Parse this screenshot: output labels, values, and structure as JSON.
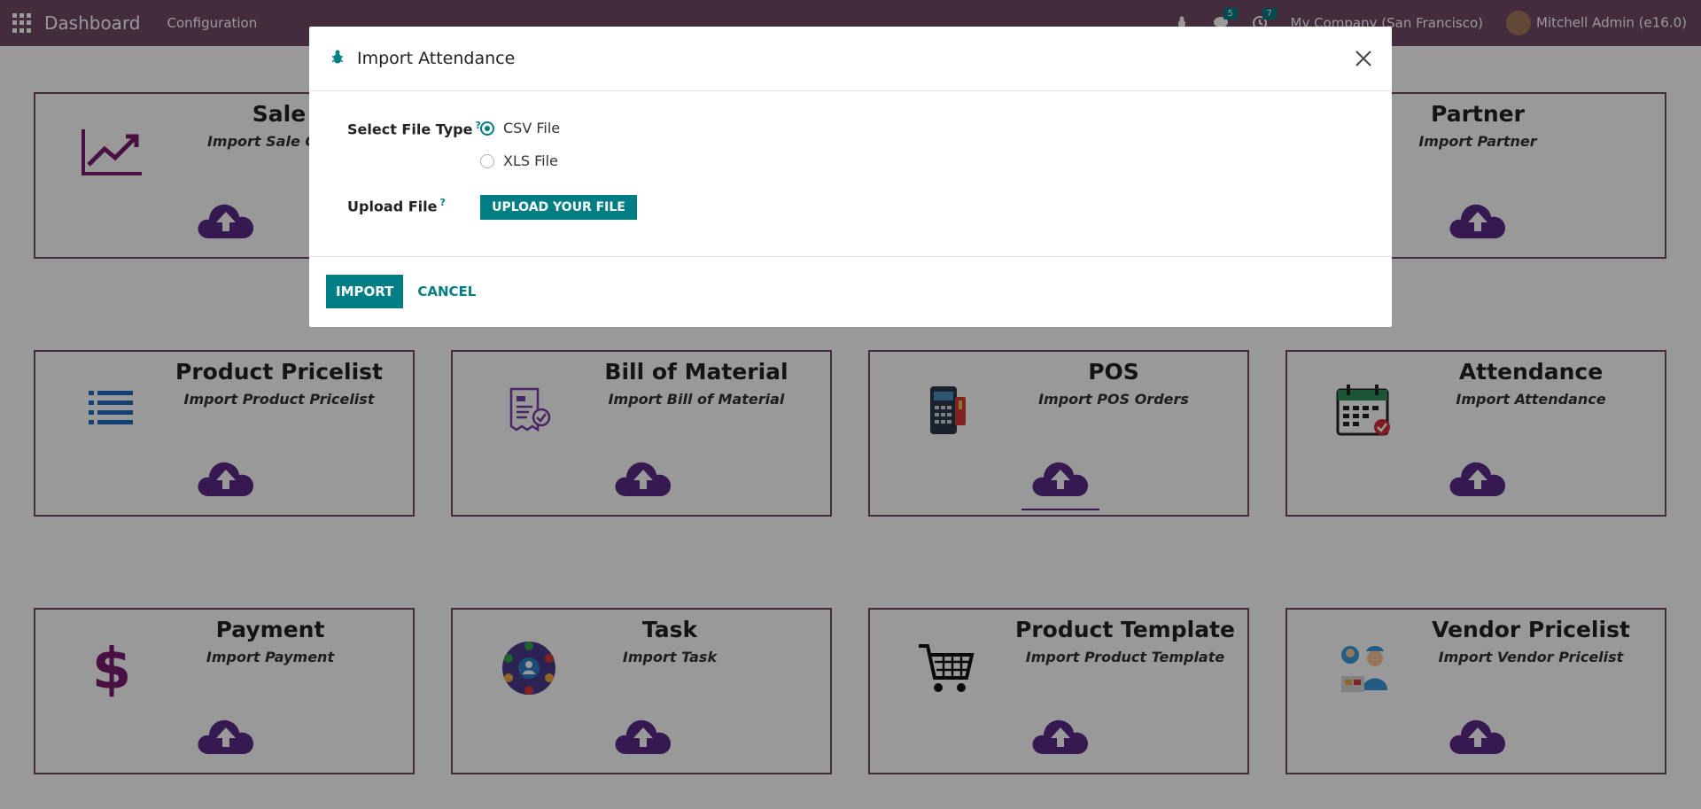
{
  "navbar": {
    "brand": "Dashboard",
    "menu": "Configuration",
    "messages_count": "5",
    "activities_count": "7",
    "company": "My Company (San Francisco)",
    "user": "Mitchell Admin (e16.0)"
  },
  "cards": [
    {
      "title": "Sale",
      "subtitle": "Import Sale Order",
      "icon": "chart-line-icon"
    },
    {
      "title": "Partner",
      "subtitle": "Import Partner",
      "icon": ""
    },
    {
      "title": "Product Pricelist",
      "subtitle": "Import Product Pricelist",
      "icon": "list-icon"
    },
    {
      "title": "Bill of Material",
      "subtitle": "Import Bill of Material",
      "icon": "document-check-icon"
    },
    {
      "title": "POS",
      "subtitle": "Import POS Orders",
      "icon": "pos-terminal-icon"
    },
    {
      "title": "Attendance",
      "subtitle": "Import Attendance",
      "icon": "calendar-check-icon"
    },
    {
      "title": "Payment",
      "subtitle": "Import Payment",
      "icon": "dollar-icon"
    },
    {
      "title": "Task",
      "subtitle": "Import Task",
      "icon": "task-network-icon"
    },
    {
      "title": "Product Template",
      "subtitle": "Import Product Template",
      "icon": "shopping-cart-icon"
    },
    {
      "title": "Vendor Pricelist",
      "subtitle": "Import Vendor Pricelist",
      "icon": "vendor-icon"
    }
  ],
  "modal": {
    "title": "Import Attendance",
    "file_type_label": "Select File Type",
    "help_mark": "?",
    "options": [
      {
        "label": "CSV File",
        "checked": true
      },
      {
        "label": "XLS File",
        "checked": false
      }
    ],
    "upload_label": "Upload File",
    "upload_button": "UPLOAD YOUR FILE",
    "import_button": "IMPORT",
    "cancel_button": "CANCEL"
  },
  "colors": {
    "brand": "#714B67",
    "accent": "#017e84",
    "cloud": "#5b2a86"
  }
}
